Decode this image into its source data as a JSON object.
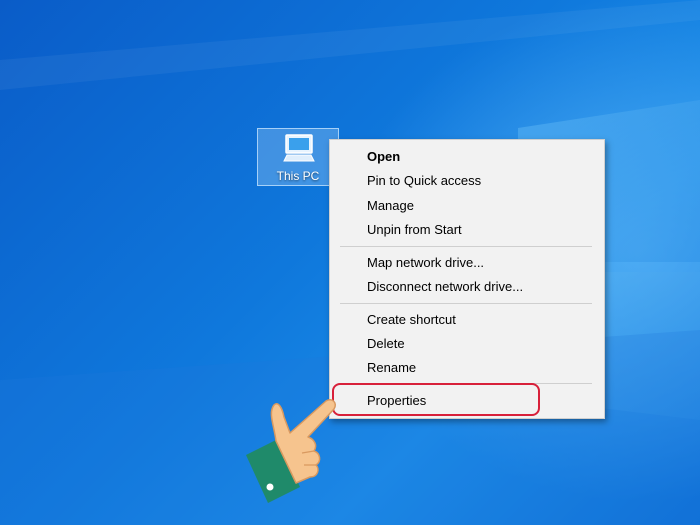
{
  "desktop": {
    "icon_label": "This PC",
    "icon_name": "computer-icon"
  },
  "context_menu": {
    "items": [
      {
        "label": "Open",
        "bold": true
      },
      {
        "label": "Pin to Quick access"
      },
      {
        "label": "Manage"
      },
      {
        "label": "Unpin from Start"
      },
      {
        "label": "Map network drive..."
      },
      {
        "label": "Disconnect network drive..."
      },
      {
        "label": "Create shortcut"
      },
      {
        "label": "Delete"
      },
      {
        "label": "Rename"
      },
      {
        "label": "Properties"
      }
    ]
  },
  "annotation": {
    "highlight_color": "#d8203a",
    "pointer_icon": "pointing-hand-icon"
  },
  "colors": {
    "wallpaper_blue": "#0f78dc",
    "menu_bg": "#f2f2f2"
  }
}
